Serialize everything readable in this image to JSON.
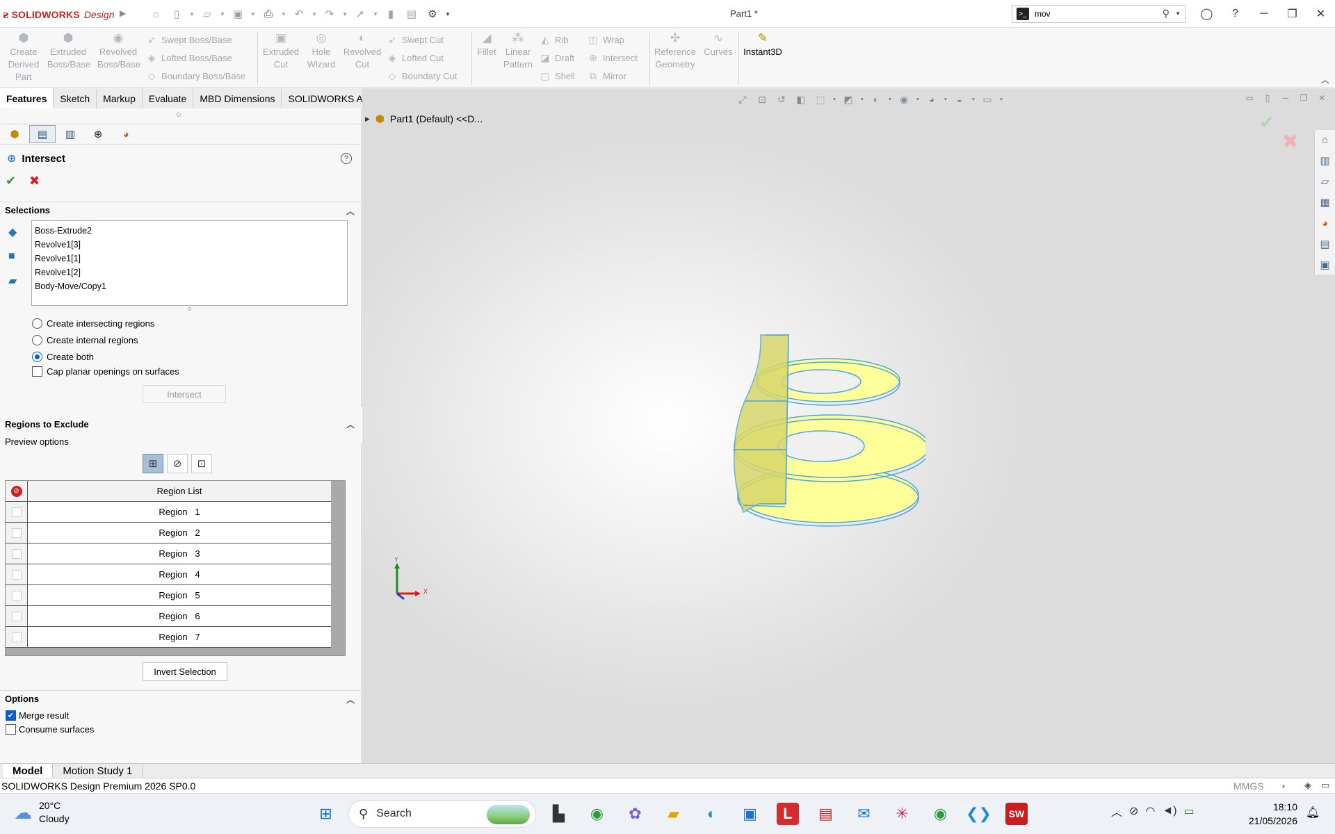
{
  "app": {
    "brand": "SOLIDWORKS",
    "edition": "Design",
    "document_title": "Part1 *"
  },
  "search": {
    "value": "mov"
  },
  "command_manager": {
    "large_buttons": [
      {
        "label": "Create Derived Part",
        "icon": "derived-part-icon"
      },
      {
        "label": "Extruded Boss/Base",
        "icon": "extrude-icon"
      },
      {
        "label": "Revolved Boss/Base",
        "icon": "revolve-icon"
      },
      {
        "label": "Extruded Cut",
        "icon": "extruded-cut-icon"
      },
      {
        "label": "Hole Wizard",
        "icon": "hole-wizard-icon"
      },
      {
        "label": "Revolved Cut",
        "icon": "revolved-cut-icon"
      },
      {
        "label": "Fillet",
        "icon": "fillet-icon"
      },
      {
        "label": "Linear Pattern",
        "icon": "linear-pattern-icon"
      },
      {
        "label": "Reference Geometry",
        "icon": "reference-geometry-icon"
      },
      {
        "label": "Curves",
        "icon": "curves-icon"
      },
      {
        "label": "Instant3D",
        "icon": "instant3d-icon"
      }
    ],
    "boss_col": [
      "Swept Boss/Base",
      "Lofted Boss/Base",
      "Boundary Boss/Base"
    ],
    "cut_col": [
      "Swept Cut",
      "Lofted Cut",
      "Boundary Cut"
    ],
    "rib_col": [
      "Rib",
      "Draft",
      "Shell"
    ],
    "wrap_col": [
      "Wrap",
      "Intersect",
      "Mirror"
    ]
  },
  "tabs": [
    "Features",
    "Sketch",
    "Markup",
    "Evaluate",
    "MBD Dimensions",
    "SOLIDWORKS Add-Ins"
  ],
  "property_manager": {
    "title": "Intersect",
    "help": "?",
    "selections_header": "Selections",
    "selections": [
      "Boss-Extrude2",
      "Revolve1[3]",
      "Revolve1[1]",
      "Revolve1[2]",
      "Body-Move/Copy1"
    ],
    "radio_options": [
      {
        "label": "Create intersecting regions",
        "checked": false
      },
      {
        "label": "Create internal regions",
        "checked": false
      },
      {
        "label": "Create both",
        "checked": true
      }
    ],
    "cap_label": "Cap planar openings on surfaces",
    "cap_checked": false,
    "intersect_button": "Intersect",
    "regions_header": "Regions to Exclude",
    "preview_label": "Preview options",
    "region_list_header": "Region List",
    "regions": [
      "Region   1",
      "Region   2",
      "Region   3",
      "Region   4",
      "Region   5",
      "Region   6",
      "Region   7"
    ],
    "invert_button": "Invert Selection",
    "options_header": "Options",
    "merge_label": "Merge result",
    "merge_checked": true,
    "consume_label": "Consume surfaces",
    "consume_checked": false
  },
  "viewport": {
    "tree_label": "Part1  (Default) <<D...",
    "model_color": "#ffff9a",
    "edge_color": "#4aa8e0"
  },
  "bottom_tabs": [
    "Model",
    "Motion Study 1"
  ],
  "status": {
    "text": "SOLIDWORKS Design Premium 2026 SP0.0",
    "units": "MMGS"
  },
  "taskbar": {
    "temperature": "20°C",
    "condition": "Cloudy",
    "search_placeholder": "Search",
    "time": "18:10",
    "date": "21/05/2026"
  }
}
